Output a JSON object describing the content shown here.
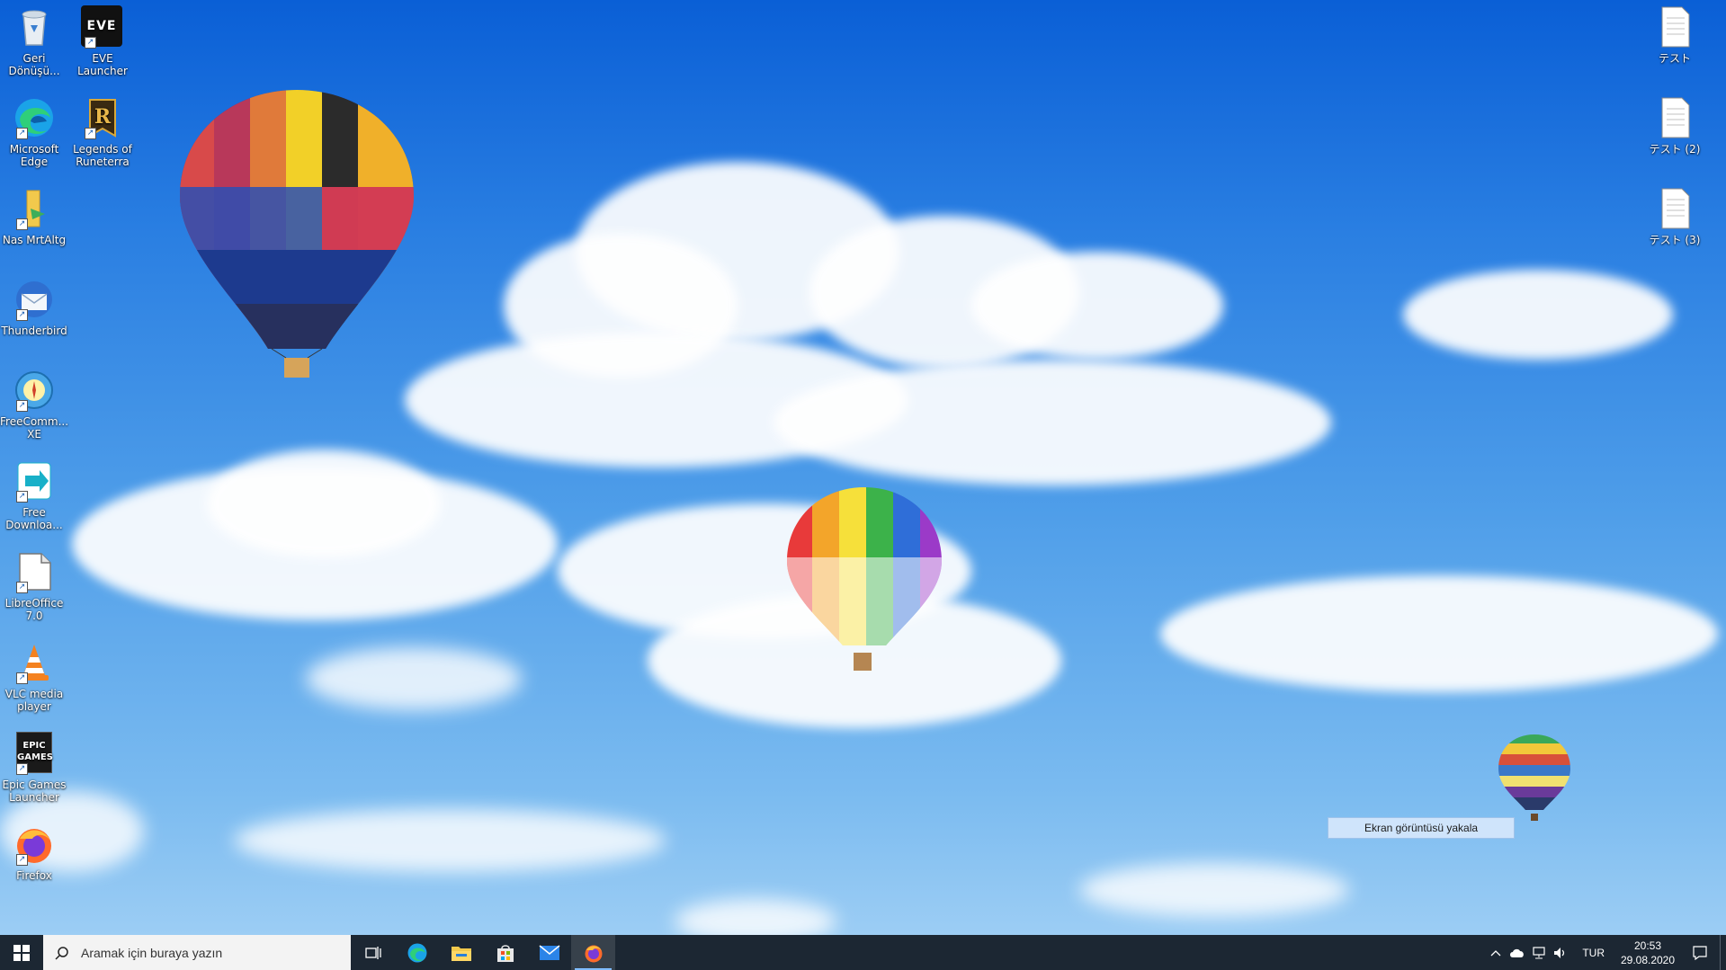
{
  "desktop_icons_left": [
    {
      "name": "recycle-bin",
      "label": "Geri Dönüşü..."
    },
    {
      "name": "eve-launcher",
      "label": "EVE Launcher"
    },
    {
      "name": "microsoft-edge",
      "label": "Microsoft Edge"
    },
    {
      "name": "legends-of-runeterra",
      "label": "Legends of Runeterra"
    },
    {
      "name": "nas-mrtaltg",
      "label": "Nas MrtAltg"
    },
    {
      "name": "thunderbird",
      "label": "Thunderbird"
    },
    {
      "name": "freecommander",
      "label": "FreeComm... XE"
    },
    {
      "name": "free-download-manager",
      "label": "Free Downloa..."
    },
    {
      "name": "libreoffice",
      "label": "LibreOffice 7.0"
    },
    {
      "name": "vlc",
      "label": "VLC media player"
    },
    {
      "name": "epic-games",
      "label": "Epic Games Launcher"
    },
    {
      "name": "firefox",
      "label": "Firefox"
    }
  ],
  "eve_icon_text": "EVE",
  "epic_icon_text": "EPIC GAMES",
  "desktop_icons_right": [
    {
      "name": "test-file-1",
      "label": "テスト"
    },
    {
      "name": "test-file-2",
      "label": "テスト (2)"
    },
    {
      "name": "test-file-3",
      "label": "テスト (3)"
    }
  ],
  "tooltip": "Ekran görüntüsü yakala",
  "taskbar": {
    "search_placeholder": "Aramak için buraya yazın",
    "apps": [
      "task-view",
      "edge",
      "file-explorer",
      "microsoft-store",
      "mail",
      "firefox"
    ],
    "active_app": "firefox",
    "language": "TUR",
    "time": "20:53",
    "date": "29.08.2020"
  },
  "colors": {
    "taskbar_bg": "#1c2733",
    "sky_top": "#0a5fd6",
    "sky_bottom": "#9ccdf4",
    "accent": "#7fbcff"
  }
}
